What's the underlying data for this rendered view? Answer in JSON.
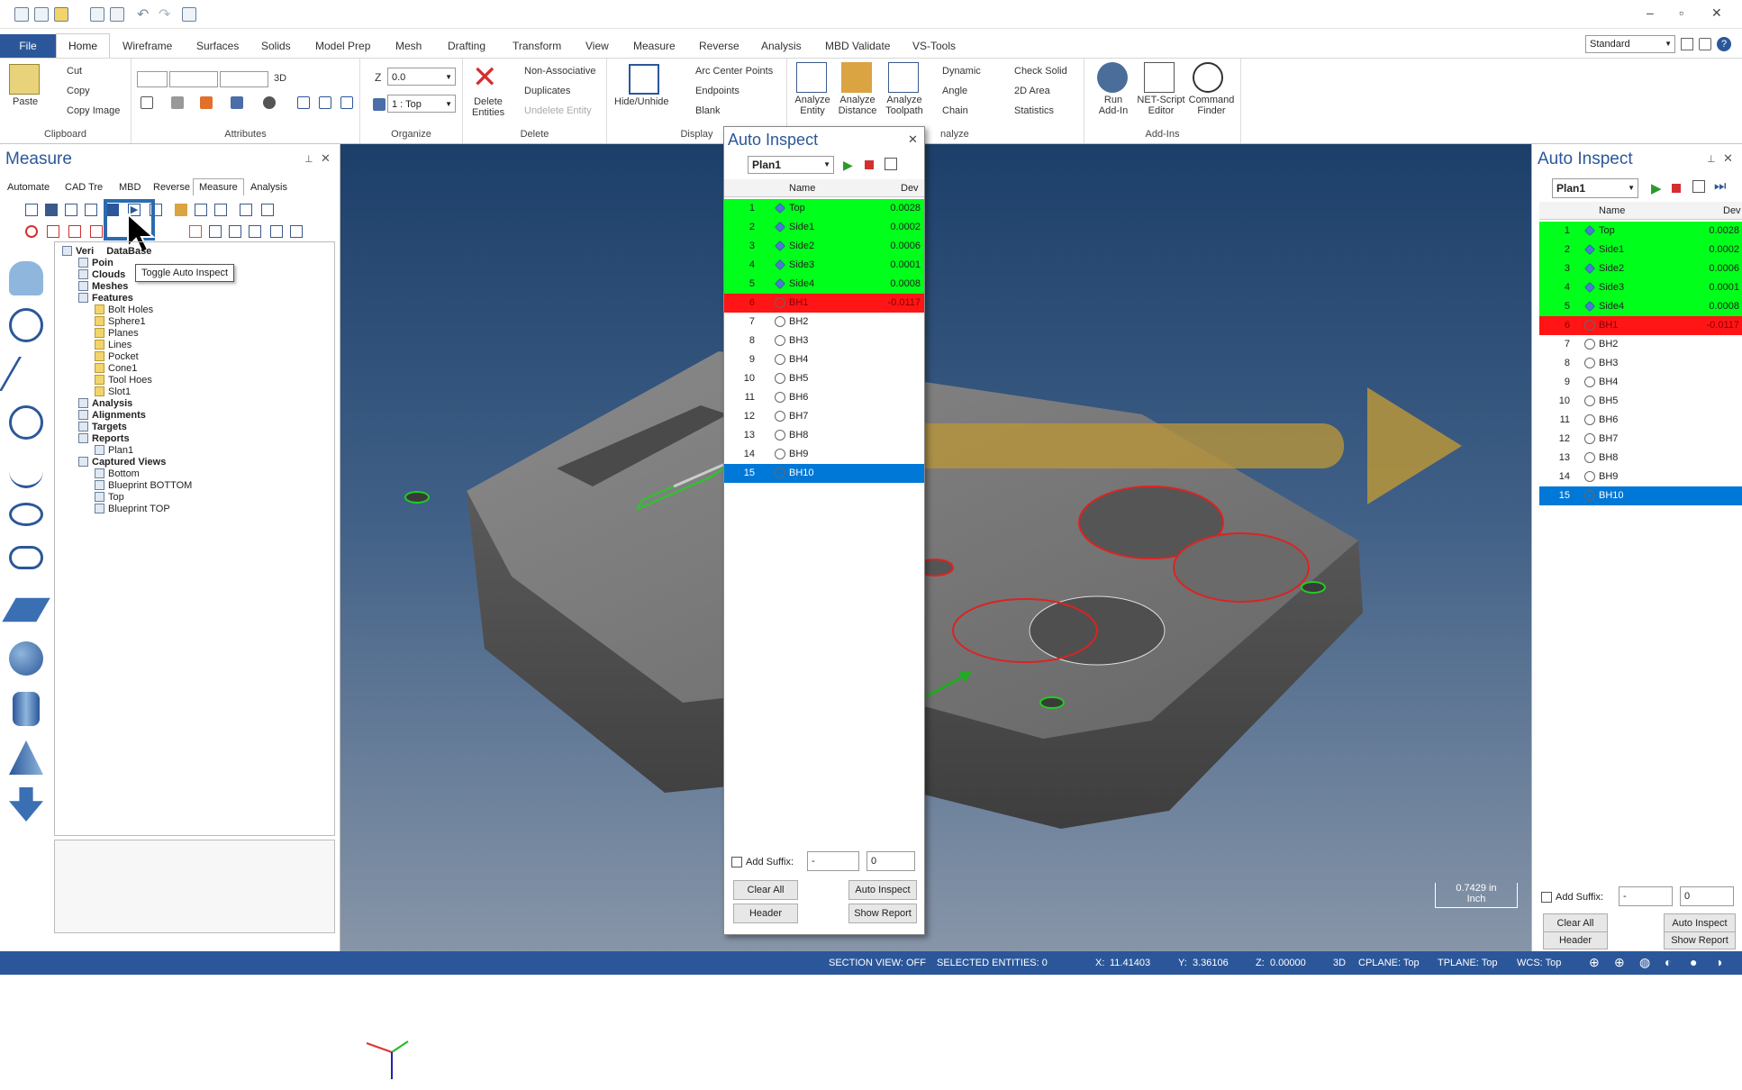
{
  "quick_access": {
    "buttons": [
      "new",
      "save",
      "open",
      "print",
      "print-preview",
      "undo",
      "redo",
      "customize"
    ],
    "window_controls": [
      "–",
      "▫",
      "✕"
    ]
  },
  "tabs": [
    "File",
    "Home",
    "Wireframe",
    "Surfaces",
    "Solids",
    "Model Prep",
    "Mesh",
    "Drafting",
    "Transform",
    "View",
    "Measure",
    "Reverse",
    "Analysis",
    "MBD Validate",
    "VS-Tools"
  ],
  "style_dropdown": "Standard",
  "ribbon": {
    "clipboard": {
      "label": "Clipboard",
      "paste": "Paste",
      "cut": "Cut",
      "copy": "Copy",
      "copy_image": "Copy Image"
    },
    "attributes": {
      "label": "Attributes",
      "mode": "3D"
    },
    "organize": {
      "label": "Organize",
      "z_label": "Z",
      "z_value": "0.0",
      "level": "1 : Top"
    },
    "delete": {
      "label": "Delete",
      "delete_entities": "Delete Entities",
      "non_assoc": "Non-Associative",
      "duplicates": "Duplicates",
      "undelete": "Undelete Entity"
    },
    "display": {
      "label": "Display",
      "hide_unhide": "Hide/Unhide",
      "arc_center": "Arc Center Points",
      "endpoints": "Endpoints",
      "blank": "Blank"
    },
    "analyze": {
      "label": "nalyze",
      "analyze_entity": "Analyze Entity",
      "analyze_distance": "Analyze Distance",
      "analyze_toolpath": "Analyze Toolpath",
      "dynamic": "Dynamic",
      "angle": "Angle",
      "chain": "Chain",
      "check_solid": "Check Solid",
      "area_2d": "2D Area",
      "statistics": "Statistics"
    },
    "addins": {
      "label": "Add-Ins",
      "run_addin": "Run Add-In",
      "net_script": "NET-Script Editor",
      "command_finder": "Command Finder"
    }
  },
  "measure_panel": {
    "title": "Measure",
    "tabs": [
      "Automate",
      "CAD Tre",
      "MBD",
      "Reverse",
      "Measure",
      "Analysis"
    ],
    "tooltip": "Toggle Auto Inspect",
    "tree": [
      {
        "text": "Veri",
        "text2": "DataBase",
        "indent": 0,
        "bold": true
      },
      {
        "text": "Poin",
        "indent": 1,
        "bold": true
      },
      {
        "text": "Clouds",
        "indent": 1,
        "bold": true
      },
      {
        "text": "Meshes",
        "indent": 1,
        "bold": true
      },
      {
        "text": "Features",
        "indent": 1,
        "bold": true
      },
      {
        "text": "Bolt Holes",
        "indent": 2,
        "bold": false
      },
      {
        "text": "Sphere1",
        "indent": 2,
        "bold": false
      },
      {
        "text": "Planes",
        "indent": 2,
        "bold": false
      },
      {
        "text": "Lines",
        "indent": 2,
        "bold": false
      },
      {
        "text": "Pocket",
        "indent": 2,
        "bold": false
      },
      {
        "text": "Cone1",
        "indent": 2,
        "bold": false
      },
      {
        "text": "Tool Hoes",
        "indent": 2,
        "bold": false
      },
      {
        "text": "Slot1",
        "indent": 2,
        "bold": false
      },
      {
        "text": "Analysis",
        "indent": 1,
        "bold": true
      },
      {
        "text": "Alignments",
        "indent": 1,
        "bold": true
      },
      {
        "text": "Targets",
        "indent": 1,
        "bold": true
      },
      {
        "text": "Reports",
        "indent": 1,
        "bold": true
      },
      {
        "text": "Plan1",
        "indent": 2,
        "bold": false
      },
      {
        "text": "Captured Views",
        "indent": 1,
        "bold": true
      },
      {
        "text": "Bottom",
        "indent": 2,
        "bold": false
      },
      {
        "text": "Blueprint BOTTOM",
        "indent": 2,
        "bold": false
      },
      {
        "text": "Top",
        "indent": 2,
        "bold": false
      },
      {
        "text": "Blueprint TOP",
        "indent": 2,
        "bold": false
      }
    ]
  },
  "auto_inspect": {
    "title": "Auto Inspect",
    "plan": "Plan1",
    "col_name": "Name",
    "col_dev": "Dev",
    "rows": [
      {
        "n": "1",
        "name": "Top",
        "dev": "0.0028",
        "status": "pass"
      },
      {
        "n": "2",
        "name": "Side1",
        "dev": "0.0002",
        "status": "pass"
      },
      {
        "n": "3",
        "name": "Side2",
        "dev": "0.0006",
        "status": "pass"
      },
      {
        "n": "4",
        "name": "Side3",
        "dev": "0.0001",
        "status": "pass"
      },
      {
        "n": "5",
        "name": "Side4",
        "dev": "0.0008",
        "status": "pass"
      },
      {
        "n": "6",
        "name": "BH1",
        "dev": "-0.0117",
        "status": "fail"
      },
      {
        "n": "7",
        "name": "BH2",
        "dev": "",
        "status": "none"
      },
      {
        "n": "8",
        "name": "BH3",
        "dev": "",
        "status": "none"
      },
      {
        "n": "9",
        "name": "BH4",
        "dev": "",
        "status": "none"
      },
      {
        "n": "10",
        "name": "BH5",
        "dev": "",
        "status": "none"
      },
      {
        "n": "11",
        "name": "BH6",
        "dev": "",
        "status": "none"
      },
      {
        "n": "12",
        "name": "BH7",
        "dev": "",
        "status": "none"
      },
      {
        "n": "13",
        "name": "BH8",
        "dev": "",
        "status": "none"
      },
      {
        "n": "14",
        "name": "BH9",
        "dev": "",
        "status": "none"
      },
      {
        "n": "15",
        "name": "BH10",
        "dev": "",
        "status": "selected"
      }
    ],
    "add_suffix": "Add Suffix:",
    "suffix_value": "-",
    "suffix_num": "0",
    "clear_all": "Clear All",
    "auto_inspect_btn": "Auto Inspect",
    "header": "Header",
    "show_report": "Show Report"
  },
  "viewport": {
    "axis_x": "X",
    "axis_y": "Y",
    "axis_z": "Z",
    "scale_value": "0.7429 in",
    "scale_unit": "Inch"
  },
  "status": {
    "section": "SECTION VIEW: OFF",
    "selected": "SELECTED ENTITIES: 0",
    "x_label": "X:",
    "x": "11.41403",
    "y_label": "Y:",
    "y": "3.36106",
    "z_label": "Z:",
    "z": "0.00000",
    "mode": "3D",
    "cplane": "CPLANE: Top",
    "tplane": "TPLANE: Top",
    "wcs": "WCS: Top"
  },
  "colors": {
    "pass": "#00ff1a",
    "fail": "#ff1515",
    "selected": "#0078d7",
    "accent": "#2b579a"
  }
}
